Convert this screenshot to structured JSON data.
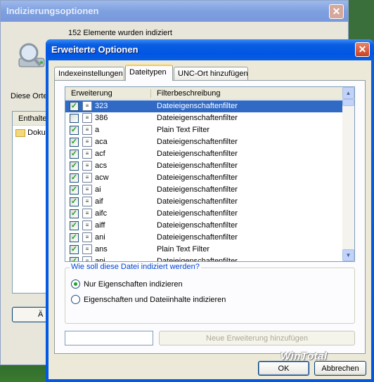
{
  "background_window": {
    "title": "Indizierungsoptionen",
    "status": "152 Elemente wurden indiziert",
    "label": "Diese Orte",
    "list_header": "Enthalte",
    "list_item": "Doku",
    "button_label": "Ä"
  },
  "dialog": {
    "title": "Erweiterte Optionen",
    "tabs": [
      "Indexeinstellungen",
      "Dateitypen",
      "UNC-Ort hinzufügen"
    ],
    "active_tab": "Dateitypen",
    "columns": {
      "extension": "Erweiterung",
      "description": "Filterbeschreibung"
    },
    "rows": [
      {
        "ext": "323",
        "desc": "Dateieigenschaftenfilter",
        "checked": true,
        "selected": true,
        "icon": "phone-file-icon"
      },
      {
        "ext": "386",
        "desc": "Dateieigenschaftenfilter",
        "checked": false,
        "selected": false,
        "icon": "driver-file-icon"
      },
      {
        "ext": "a",
        "desc": "Plain Text Filter",
        "checked": true,
        "selected": false,
        "icon": "text-file-icon"
      },
      {
        "ext": "aca",
        "desc": "Dateieigenschaftenfilter",
        "checked": true,
        "selected": false,
        "icon": "agent-file-icon"
      },
      {
        "ext": "acf",
        "desc": "Dateieigenschaftenfilter",
        "checked": true,
        "selected": false,
        "icon": "agent-file-icon"
      },
      {
        "ext": "acs",
        "desc": "Dateieigenschaftenfilter",
        "checked": true,
        "selected": false,
        "icon": "agent-file-icon"
      },
      {
        "ext": "acw",
        "desc": "Dateieigenschaftenfilter",
        "checked": true,
        "selected": false,
        "icon": "accessibility-file-icon"
      },
      {
        "ext": "ai",
        "desc": "Dateieigenschaftenfilter",
        "checked": true,
        "selected": false,
        "icon": "generic-file-icon"
      },
      {
        "ext": "aif",
        "desc": "Dateieigenschaftenfilter",
        "checked": true,
        "selected": false,
        "icon": "audio-file-icon"
      },
      {
        "ext": "aifc",
        "desc": "Dateieigenschaftenfilter",
        "checked": true,
        "selected": false,
        "icon": "audio-file-icon"
      },
      {
        "ext": "aiff",
        "desc": "Dateieigenschaftenfilter",
        "checked": true,
        "selected": false,
        "icon": "audio-file-icon"
      },
      {
        "ext": "ani",
        "desc": "Dateieigenschaftenfilter",
        "checked": true,
        "selected": false,
        "icon": "cursor-file-icon"
      },
      {
        "ext": "ans",
        "desc": "Plain Text Filter",
        "checked": true,
        "selected": false,
        "icon": "text-file-icon"
      },
      {
        "ext": "api",
        "desc": "Dateieigenschaftenfilter",
        "checked": true,
        "selected": false,
        "icon": "acrobat-file-icon"
      }
    ],
    "group_title": "Wie soll diese Datei indiziert werden?",
    "radio_options": [
      "Nur Eigenschaften indizieren",
      "Eigenschaften und Dateiinhalte indizieren"
    ],
    "radio_selected": 0,
    "new_extension_placeholder": "",
    "new_extension_button": "Neue Erweiterung hinzufügen",
    "watermark": "WinTotal",
    "ok_label": "OK",
    "cancel_label": "Abbrechen"
  },
  "colors": {
    "title_blue": "#0a5ee0",
    "selection": "#316ac5",
    "check_green": "#21a121",
    "group_title": "#0046d5"
  }
}
